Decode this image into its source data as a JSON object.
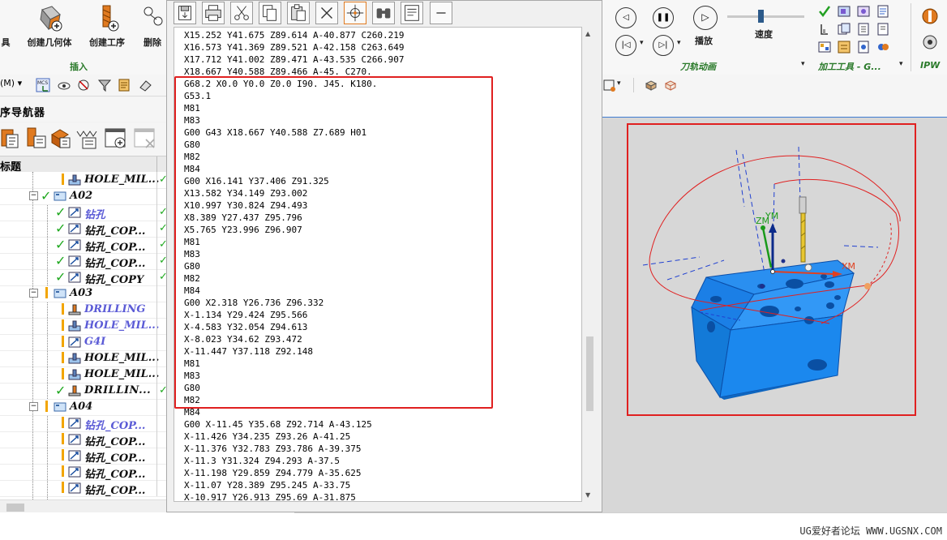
{
  "left_ribbon": {
    "buttons": [
      {
        "label": "具"
      },
      {
        "label": "创建几何体"
      },
      {
        "label": "创建工序"
      },
      {
        "label": "删除"
      }
    ],
    "group_label": "插入",
    "toolbar2": {
      "dropdown": "(M)"
    }
  },
  "navigator": {
    "title": "序导航器",
    "column_header": "标题",
    "rows": [
      {
        "label": "HOLE_MIL...",
        "style": "black",
        "check": false
      },
      {
        "label": "A02",
        "style": "black",
        "check": true
      },
      {
        "label": "钻孔",
        "style": "blue",
        "check": true
      },
      {
        "label": "钻孔_COP...",
        "style": "black",
        "check": true
      },
      {
        "label": "钻孔_COP...",
        "style": "black",
        "check": true
      },
      {
        "label": "钻孔_COP...",
        "style": "black",
        "check": true
      },
      {
        "label": "钻孔_COPY",
        "style": "black",
        "check": true
      },
      {
        "label": "A03",
        "style": "black",
        "check": false
      },
      {
        "label": "DRILLING",
        "style": "blue",
        "check": false
      },
      {
        "label": "HOLE_MIL...",
        "style": "blue",
        "check": false
      },
      {
        "label": "G4I",
        "style": "blue",
        "check": false
      },
      {
        "label": "HOLE_MIL...",
        "style": "black",
        "check": false
      },
      {
        "label": "HOLE_MIL...",
        "style": "black",
        "check": false
      },
      {
        "label": "DRILLIN...",
        "style": "black",
        "check": true
      },
      {
        "label": "A04",
        "style": "black",
        "check": false
      },
      {
        "label": "钻孔_COP...",
        "style": "blue",
        "check": false
      },
      {
        "label": "钻孔_COP...",
        "style": "black",
        "check": false
      },
      {
        "label": "钻孔_COP...",
        "style": "black",
        "check": false
      },
      {
        "label": "钻孔_COP...",
        "style": "black",
        "check": false
      },
      {
        "label": "钻孔_COP...",
        "style": "black",
        "check": false
      }
    ]
  },
  "nc_code": {
    "lines": [
      "X15.252 Y41.675 Z89.614 A-40.877 C260.219",
      "X16.573 Y41.369 Z89.521 A-42.158 C263.649",
      "X17.712 Y41.002 Z89.471 A-43.535 C266.907",
      "X18.667 Y40.588 Z89.466 A-45. C270.",
      "G68.2 X0.0 Y0.0 Z0.0 I90. J45. K180.",
      "G53.1",
      "M81",
      "M83",
      "G00 G43 X18.667 Y40.588 Z7.689 H01",
      "G80",
      "M82",
      "M84",
      "G00 X16.141 Y37.406 Z91.325",
      "X13.582 Y34.149 Z93.002",
      "X10.997 Y30.824 Z94.493",
      "X8.389 Y27.437 Z95.796",
      "X5.765 Y23.996 Z96.907",
      "M81",
      "M83",
      "G80",
      "M82",
      "M84",
      "G00 X2.318 Y26.736 Z96.332",
      "X-1.134 Y29.424 Z95.566",
      "X-4.583 Y32.054 Z94.613",
      "X-8.023 Y34.62 Z93.472",
      "X-11.447 Y37.118 Z92.148",
      "M81",
      "M83",
      "G80",
      "M82",
      "M84",
      "G00 X-11.45 Y35.68 Z92.714 A-43.125",
      "X-11.426 Y34.235 Z93.26 A-41.25",
      "X-11.376 Y32.783 Z93.786 A-39.375",
      "X-11.3 Y31.324 Z94.293 A-37.5",
      "X-11.198 Y29.859 Z94.779 A-35.625",
      "X-11.07 Y28.389 Z95.245 A-33.75",
      "X-10.917 Y26.913 Z95.69 A-31.875"
    ]
  },
  "right_ribbon": {
    "play_label": "播放",
    "speed_label": "速度",
    "group_toolpath": "刀轨动画",
    "group_tools": "加工工具 - G...",
    "group_ipw": "IPW"
  },
  "viewport": {
    "axis_zm": "ZM",
    "axis_ym": "YM",
    "axis_xm": "XM",
    "colors": {
      "part": "#1e8fff",
      "path": "#e02020",
      "rapid": "#2040d0"
    }
  },
  "watermark": "UG爱好者论坛 WWW.UGSNX.COM"
}
